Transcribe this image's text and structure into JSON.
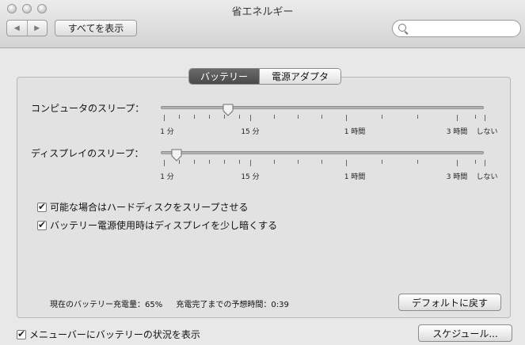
{
  "window": {
    "title": "省エネルギー"
  },
  "toolbar": {
    "back_icon": "◀",
    "forward_icon": "▶",
    "show_all_label": "すべてを表示",
    "search": {
      "value": "",
      "placeholder": ""
    }
  },
  "tabs": [
    {
      "label": "バッテリー",
      "selected": true
    },
    {
      "label": "電源アダプタ",
      "selected": false
    }
  ],
  "sliders": {
    "computer_sleep": {
      "label": "コンピュータのスリープ：",
      "value_label": "15 分",
      "ticks": [
        "1 分",
        "15 分",
        "1 時間",
        "3 時間",
        "しない"
      ]
    },
    "display_sleep": {
      "label": "ディスプレイのスリープ：",
      "value_label": "1 分",
      "ticks": [
        "1 分",
        "15 分",
        "1 時間",
        "3 時間",
        "しない"
      ]
    }
  },
  "options": [
    {
      "label": "可能な場合はハードディスクをスリープさせる",
      "checked": true
    },
    {
      "label": "バッテリー電源使用時はディスプレイを少し暗くする",
      "checked": true
    }
  ],
  "status": {
    "battery_charge": "現在のバッテリー充電量：65%",
    "time_to_full": "充電完了までの予想時間：0:39"
  },
  "buttons": {
    "restore_defaults": "デフォルトに戻す",
    "schedule": "スケジュール..."
  },
  "menubar_option": {
    "label": "メニューバーにバッテリーの状況を表示",
    "checked": true
  }
}
